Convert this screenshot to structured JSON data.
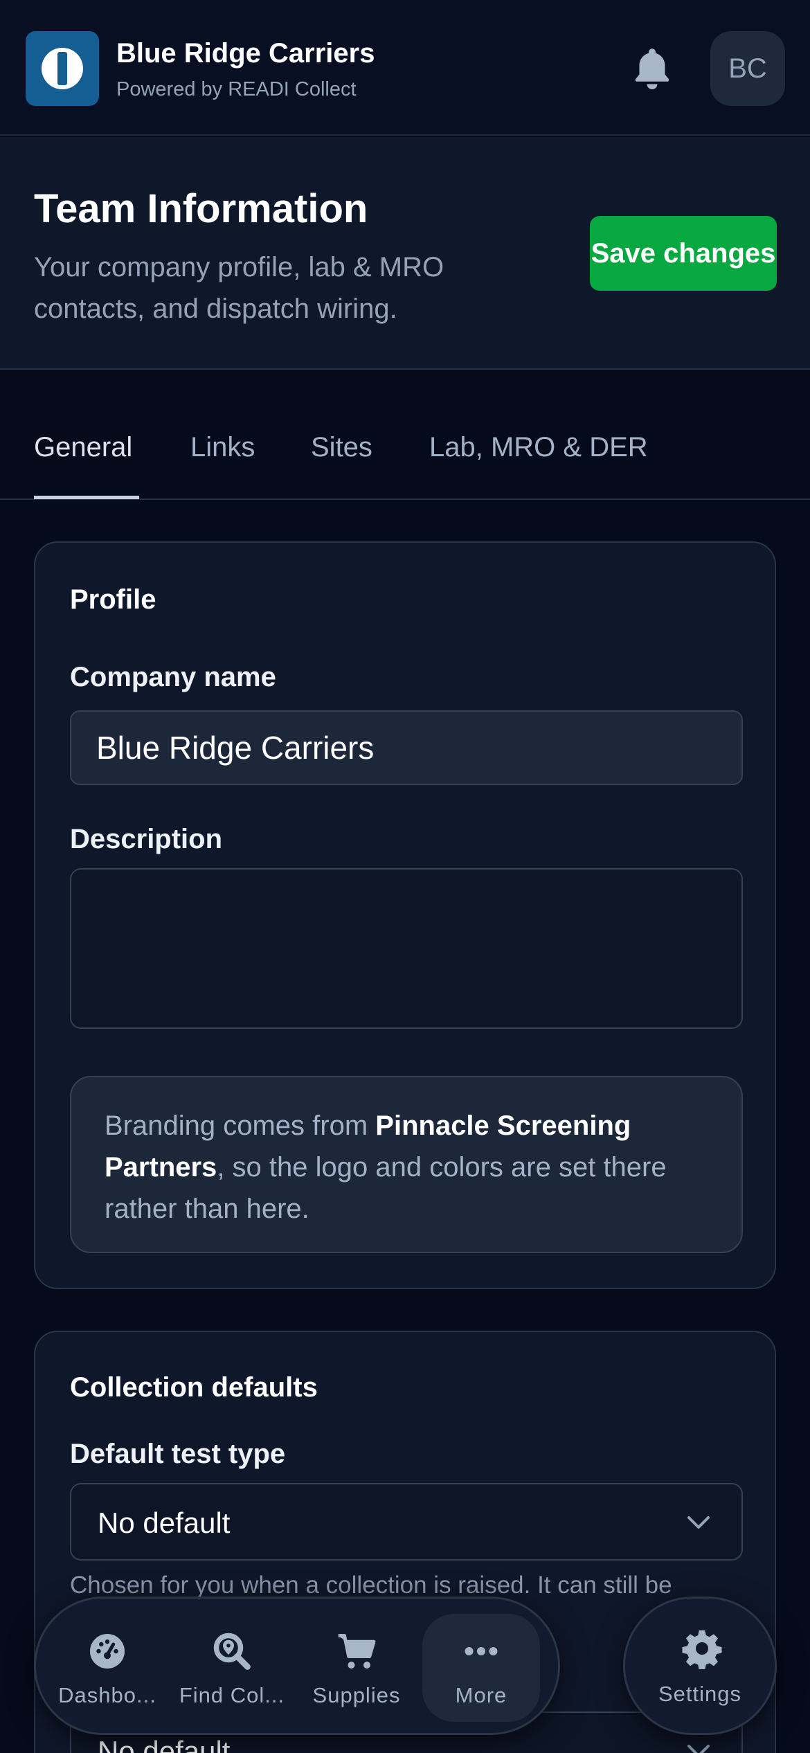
{
  "header": {
    "brand_name": "Blue Ridge Carriers",
    "brand_sub": "Powered by READI Collect",
    "avatar_initials": "BC"
  },
  "page": {
    "title": "Team Information",
    "subtitle": "Your company profile, lab & MRO contacts, and dispatch wiring.",
    "save_label": "Save changes"
  },
  "tabs": [
    {
      "label": "General",
      "active": true
    },
    {
      "label": "Links",
      "active": false
    },
    {
      "label": "Sites",
      "active": false
    },
    {
      "label": "Lab, MRO & DER",
      "active": false
    }
  ],
  "profile": {
    "title": "Profile",
    "company_label": "Company name",
    "company_value": "Blue Ridge Carriers",
    "description_label": "Description",
    "description_value": "",
    "note_prefix": "Branding comes from ",
    "note_bold": "Pinnacle Screening Partners",
    "note_suffix": ", so the logo and colors are set there rather than here."
  },
  "collection_defaults": {
    "title": "Collection defaults",
    "test_type_label": "Default test type",
    "test_type_value": "No default",
    "test_type_help": "Chosen for you when a collection is raised. It can still be",
    "second_select_value": "No default"
  },
  "bottom_nav": {
    "items": [
      {
        "label": "Dashbo...",
        "icon": "dashboard-icon",
        "active": false
      },
      {
        "label": "Find Col...",
        "icon": "find-location-icon",
        "active": false
      },
      {
        "label": "Supplies",
        "icon": "cart-icon",
        "active": false
      },
      {
        "label": "More",
        "icon": "more-icon",
        "active": true
      }
    ],
    "settings_label": "Settings"
  },
  "colors": {
    "background": "#060b1c",
    "accent_save": "#06a83f",
    "logo": "#155e94",
    "muted_text": "#94a3b8"
  }
}
